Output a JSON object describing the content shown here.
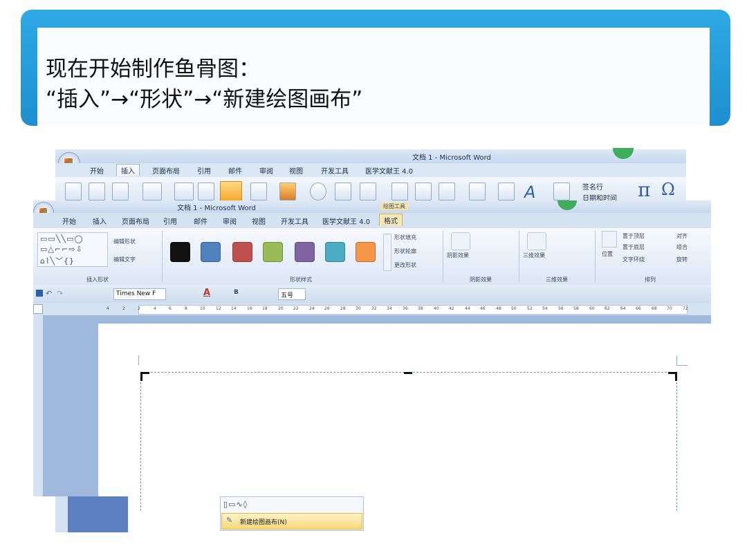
{
  "slide": {
    "title_line1": "现在开始制作鱼骨图：",
    "title_line2": "“插入”→“形状”→“新建绘图画布”"
  },
  "back_window": {
    "title": "文档 1 - Microsoft Word",
    "tabs": [
      "开始",
      "插入",
      "页面布局",
      "引用",
      "邮件",
      "审阅",
      "视图",
      "开发工具",
      "医学文献王 4.0"
    ],
    "active_tab": "插入",
    "signature_line": "签名行",
    "date_time": "日期和时间",
    "pi_symbol": "π",
    "omega_symbol": "Ω"
  },
  "front_window": {
    "title": "文档 1 - Microsoft Word",
    "context_label": "绘图工具",
    "tabs": [
      "开始",
      "插入",
      "页面布局",
      "引用",
      "邮件",
      "审阅",
      "视图",
      "开发工具",
      "医学文献王 4.0"
    ],
    "format_tab": "格式",
    "groups": {
      "insert_shapes": {
        "label": "插入形状",
        "edit_shape": "编辑形状",
        "edit_text": "编辑文字"
      },
      "shape_styles": {
        "label": "形状样式",
        "fill": "形状填充",
        "outline": "形状轮廓",
        "change": "更改形状",
        "swatches": [
          "#111111",
          "#4f81bd",
          "#c0504d",
          "#9bbb59",
          "#8064a2",
          "#4bacc6",
          "#f79646"
        ]
      },
      "shadow": {
        "label": "阴影效果",
        "button": "阴影效果"
      },
      "threed": {
        "label": "三维效果",
        "button": "三维效果"
      },
      "arrange": {
        "label": "排列",
        "position": "位置",
        "bring_front": "置于顶层",
        "send_back": "置于底层",
        "text_wrap": "文字环绕",
        "align": "对齐",
        "group": "组合",
        "rotate": "旋转"
      }
    },
    "qat": {
      "font": "Times New F",
      "size": "五号"
    },
    "ruler_ticks": [
      "4",
      "2",
      "2",
      "4",
      "6",
      "8",
      "10",
      "12",
      "14",
      "16",
      "18",
      "20",
      "22",
      "24",
      "26",
      "28",
      "30",
      "32",
      "34",
      "36",
      "38",
      "40",
      "42",
      "44",
      "46",
      "48",
      "50",
      "52",
      "54",
      "56",
      "58",
      "60",
      "62",
      "64",
      "66",
      "68",
      "70",
      "72"
    ]
  },
  "context_menu": {
    "new_canvas": "新建绘图画布(N)"
  }
}
